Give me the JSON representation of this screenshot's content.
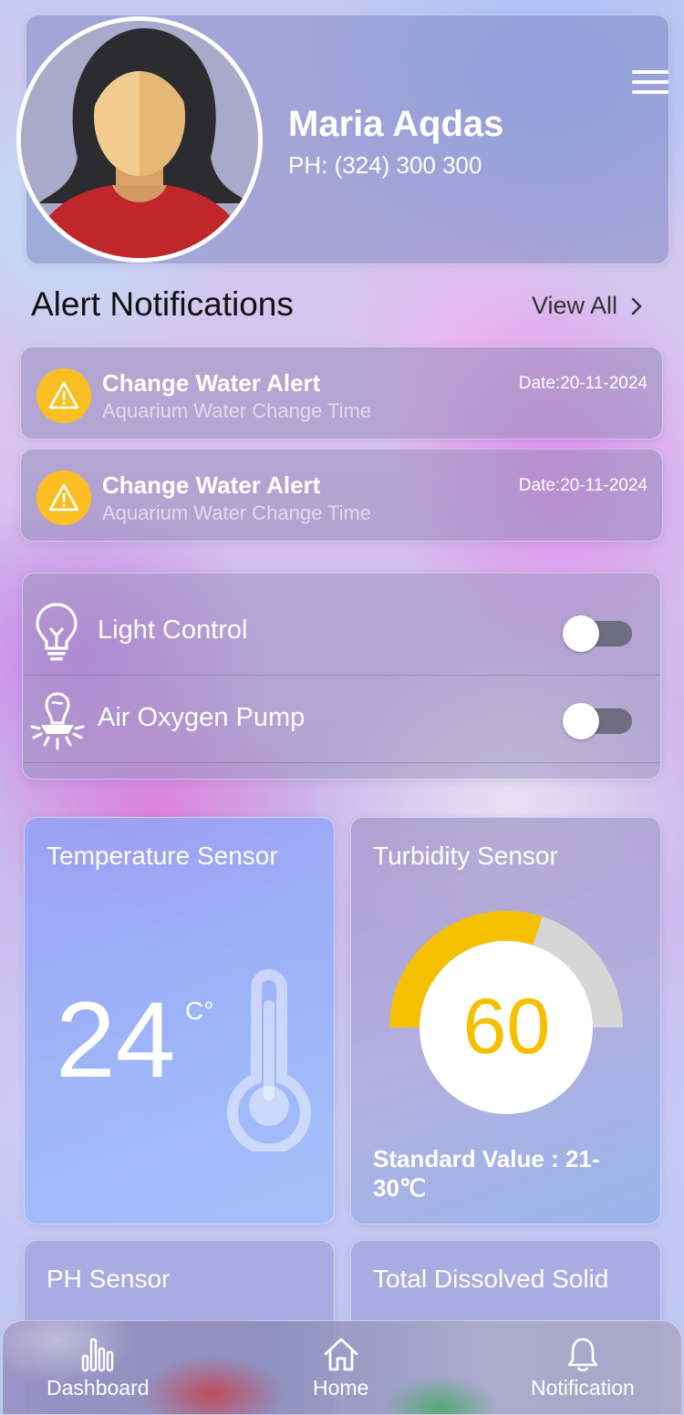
{
  "profile": {
    "name": "Maria Aqdas",
    "phone": "PH: (324) 300 300"
  },
  "alerts_section": {
    "title": "Alert Notifications",
    "view_all": "View All",
    "items": [
      {
        "title": "Change Water Alert",
        "subtitle": "Aquarium Water Change Time",
        "date": "Date:20-11-2024"
      },
      {
        "title": "Change Water Alert",
        "subtitle": "Aquarium Water Change Time",
        "date": "Date:20-11-2024"
      }
    ]
  },
  "controls": [
    {
      "label": "Light Control",
      "icon": "lightbulb-icon",
      "on": false
    },
    {
      "label": "Air Oxygen Pump",
      "icon": "oxygen-pump-icon",
      "on": false
    }
  ],
  "sensors": {
    "temperature": {
      "title": "Temperature Sensor",
      "value": "24",
      "unit": "C°"
    },
    "turbidity": {
      "title": "Turbidity Sensor",
      "value": "60",
      "gauge_fraction": 0.6,
      "standard": "Standard Value : 21-30℃"
    },
    "ph": {
      "title": "PH Sensor"
    },
    "tds": {
      "title": "Total Dissolved Solid"
    }
  },
  "nav": {
    "dashboard": "Dashboard",
    "home": "Home",
    "notification": "Notification"
  },
  "colors": {
    "alert_badge": "#fbbf24",
    "gauge_fill": "#f5c000",
    "gauge_track": "#d6d6d6",
    "toggle_track": "#6f6d80"
  }
}
